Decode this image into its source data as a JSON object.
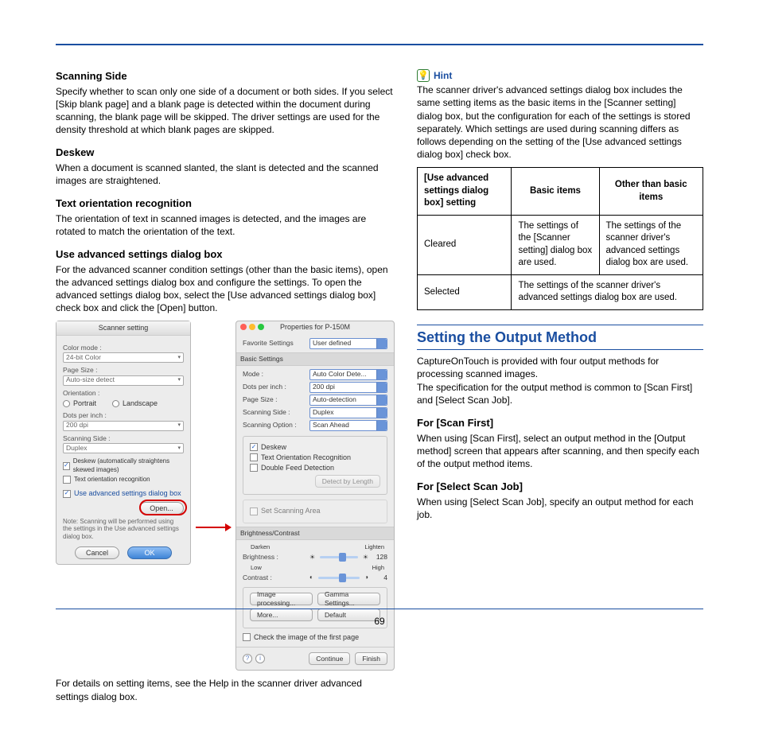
{
  "page_number": "69",
  "left": {
    "scanning_side": {
      "heading": "Scanning Side",
      "body": "Specify whether to scan only one side of a document or both sides. If you select [Skip blank page] and a blank page is detected within the document during scanning, the blank page will be skipped. The driver settings are used for the density threshold at which blank pages are skipped."
    },
    "deskew": {
      "heading": "Deskew",
      "body": "When a document is scanned slanted, the slant is detected and the scanned images are straightened."
    },
    "text_orientation": {
      "heading": "Text orientation recognition",
      "body": "The orientation of text in scanned images is detected, and the images are rotated to match the orientation of the text."
    },
    "use_adv": {
      "heading": "Use advanced settings dialog box",
      "body": "For the advanced scanner condition settings (other than the basic items), open the advanced settings dialog box and configure the settings. To open the advanced settings dialog box, select the [Use advanced settings dialog box] check box and click the [Open] button."
    },
    "figure": {
      "dlg1": {
        "title": "Scanner setting",
        "color_mode_lbl": "Color mode :",
        "color_mode_val": "24-bit Color",
        "page_size_lbl": "Page Size :",
        "page_size_val": "Auto-size detect",
        "orientation_lbl": "Orientation :",
        "orientation_portrait": "Portrait",
        "orientation_landscape": "Landscape",
        "dpi_lbl": "Dots per inch :",
        "dpi_val": "200 dpi",
        "side_lbl": "Scanning Side :",
        "side_val": "Duplex",
        "cb_deskew": "Deskew (automatically straightens skewed images)",
        "cb_text": "Text orientation recognition",
        "cb_useadv": "Use advanced settings dialog box",
        "open_btn": "Open...",
        "note": "Note: Scanning will be performed using the settings in the Use advanced settings dialog box.",
        "cancel": "Cancel",
        "ok": "OK"
      },
      "dlg2": {
        "title": "Properties for P-150M",
        "fav_lbl": "Favorite Settings",
        "fav_val": "User defined",
        "basic_hdr": "Basic Settings",
        "mode_lbl": "Mode :",
        "mode_val": "Auto Color Dete...",
        "dpi_lbl": "Dots per inch :",
        "dpi_val": "200 dpi",
        "ps_lbl": "Page Size :",
        "ps_val": "Auto-detection",
        "side_lbl": "Scanning Side :",
        "side_val": "Duplex",
        "opt_lbl": "Scanning Option :",
        "opt_val": "Scan Ahead",
        "cb_deskew": "Deskew",
        "cb_text": "Text Orientation Recognition",
        "cb_dfd": "Double Feed Detection",
        "detect_btn": "Detect by Length",
        "cb_area": "Set Scanning Area",
        "bc_hdr": "Brightness/Contrast",
        "brightness_lbl": "Brightness :",
        "brightness_val": "128",
        "darken": "Darken",
        "lighten": "Lighten",
        "contrast_lbl": "Contrast :",
        "contrast_val": "4",
        "low": "Low",
        "high": "High",
        "imgproc": "Image processing...",
        "gamma": "Gamma Settings...",
        "more": "More...",
        "default": "Default",
        "cb_checkimg": "Check the image of the first page",
        "continue": "Continue",
        "finish": "Finish"
      }
    },
    "footnote": "For details on setting items, see the Help in the scanner driver advanced settings dialog box."
  },
  "right": {
    "hint_label": "Hint",
    "hint_body": "The scanner driver's advanced settings dialog box includes the same setting items as the basic items in the [Scanner setting] dialog box, but the configuration for each of the settings is stored separately. Which settings are used during scanning differs as follows depending on the setting of the [Use advanced settings dialog box] check box.",
    "table": {
      "h1": "[Use advanced settings dialog box] setting",
      "h2": "Basic items",
      "h3": "Other than basic items",
      "r1c1": "Cleared",
      "r1c2": "The settings of the [Scanner setting] dialog box are used.",
      "r1c3": "The settings of the scanner driver's advanced settings dialog box are used.",
      "r2c1": "Selected",
      "r2c2": "The settings of the scanner driver's advanced settings dialog box are used."
    },
    "output": {
      "heading": "Setting the Output Method",
      "p1": "CaptureOnTouch is provided with four output methods for processing scanned images.",
      "p2": "The specification for the output method is common to [Scan First] and [Select Scan Job].",
      "scan_first_h": "For [Scan First]",
      "scan_first_b": "When using [Scan First], select an output method in the [Output method] screen that appears after scanning, and then specify each of the output method items.",
      "select_job_h": "For [Select Scan Job]",
      "select_job_b": "When using [Select Scan Job], specify an output method for each job."
    }
  }
}
